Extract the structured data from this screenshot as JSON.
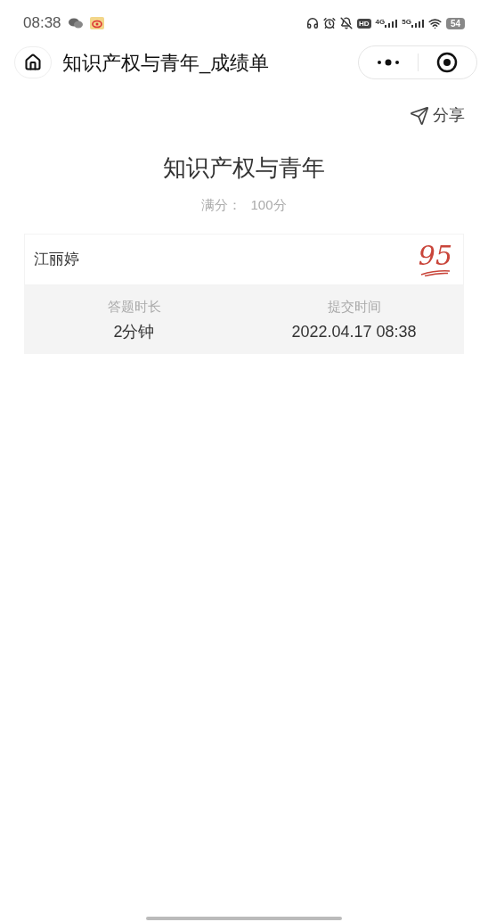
{
  "status_bar": {
    "time": "08:38",
    "hd_badge": "HD",
    "sim_badges": [
      "4G",
      "5G"
    ],
    "battery": "54"
  },
  "nav_bar": {
    "title": "知识产权与青年_成绩单"
  },
  "share": {
    "label": "分享"
  },
  "exam": {
    "title": "知识产权与青年",
    "full_score_label": "满分：",
    "full_score": "100分"
  },
  "result": {
    "name": "江丽婷",
    "score": "95",
    "stats": [
      {
        "label": "答题时长",
        "value": "2分钟"
      },
      {
        "label": "提交时间",
        "value": "2022.04.17 08:38"
      }
    ]
  }
}
